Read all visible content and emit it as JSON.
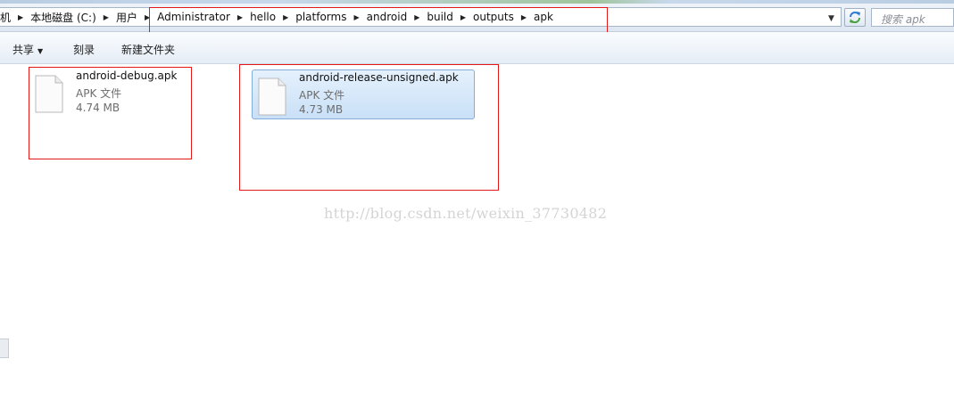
{
  "address_bar": {
    "crumbs": [
      "机",
      "本地磁盘 (C:)",
      "用户",
      "Administrator",
      "hello",
      "platforms",
      "android",
      "build",
      "outputs",
      "apk"
    ]
  },
  "search": {
    "placeholder": "搜索 apk"
  },
  "toolbar": {
    "share_label": "共享",
    "burn_label": "刻录",
    "new_folder_label": "新建文件夹"
  },
  "files": [
    {
      "name": "android-debug.apk",
      "type": "APK 文件",
      "size": "4.74 MB",
      "selected": false
    },
    {
      "name": "android-release-unsigned.apk",
      "type": "APK 文件",
      "size": "4.73 MB",
      "selected": true
    }
  ],
  "watermark": "http://blog.csdn.net/weixin_37730482",
  "colors": {
    "highlight": "#e51818",
    "selection": "#c9e0f7"
  },
  "icons": [
    "chevron-right-icon",
    "dropdown-arrow-icon",
    "refresh-icon",
    "file-icon"
  ]
}
